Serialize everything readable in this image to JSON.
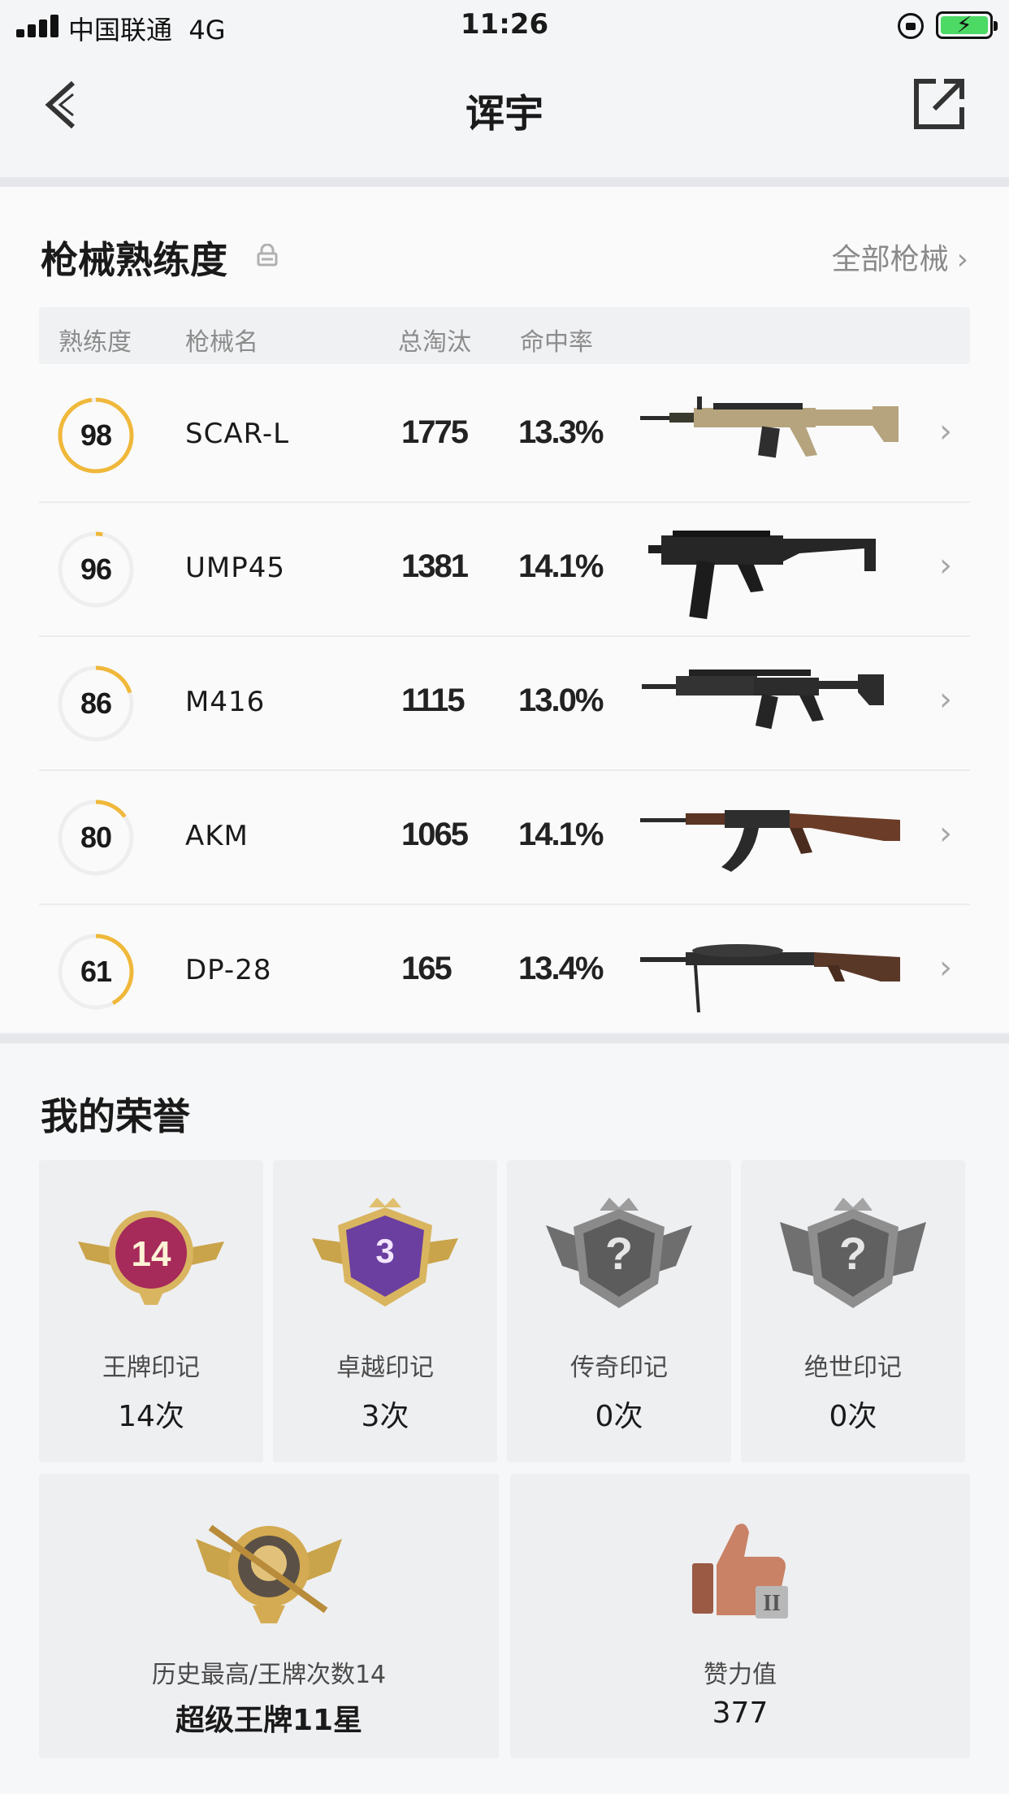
{
  "status_bar": {
    "carrier": "中国联通",
    "network": "4G",
    "time": "11:26"
  },
  "nav": {
    "title": "诨宇",
    "back_icon": "chevron-left-icon",
    "share_icon": "share-icon"
  },
  "weapons": {
    "title": "枪械熟练度",
    "all_link": "全部枪械",
    "columns": [
      "熟练度",
      "枪械名",
      "总淘汰",
      "命中率"
    ],
    "ring_color": "#f0b83a",
    "rows": [
      {
        "proficiency": "98",
        "proficiency_pct": 0.98,
        "name": "SCAR-L",
        "kills": "1775",
        "accuracy": "13.3%",
        "icon": "scar-l-rifle-image"
      },
      {
        "proficiency": "96",
        "proficiency_pct": 0.03,
        "name": "UMP45",
        "kills": "1381",
        "accuracy": "14.1%",
        "icon": "ump45-smg-image"
      },
      {
        "proficiency": "86",
        "proficiency_pct": 0.2,
        "name": "M416",
        "kills": "1115",
        "accuracy": "13.0%",
        "icon": "m416-rifle-image"
      },
      {
        "proficiency": "80",
        "proficiency_pct": 0.15,
        "name": "AKM",
        "kills": "1065",
        "accuracy": "14.1%",
        "icon": "akm-rifle-image"
      },
      {
        "proficiency": "61",
        "proficiency_pct": 0.42,
        "name": "DP-28",
        "kills": "165",
        "accuracy": "13.4%",
        "icon": "dp28-lmg-image"
      }
    ]
  },
  "honors": {
    "title": "我的荣誉",
    "marks": [
      {
        "label": "王牌印记",
        "value": "14次",
        "badge_text": "14",
        "icon": "ace-badge-icon"
      },
      {
        "label": "卓越印记",
        "value": "3次",
        "badge_text": "3",
        "icon": "excellence-badge-icon"
      },
      {
        "label": "传奇印记",
        "value": "0次",
        "badge_text": "?",
        "icon": "legend-badge-icon"
      },
      {
        "label": "绝世印记",
        "value": "0次",
        "badge_text": "?",
        "icon": "peerless-badge-icon"
      }
    ],
    "best": {
      "label": "历史最高/王牌次数14",
      "value": "超级王牌11星",
      "icon": "super-ace-badge-icon"
    },
    "likes": {
      "label": "赞力值",
      "value": "377",
      "badge_text": "II",
      "icon": "thumbs-up-icon"
    }
  }
}
